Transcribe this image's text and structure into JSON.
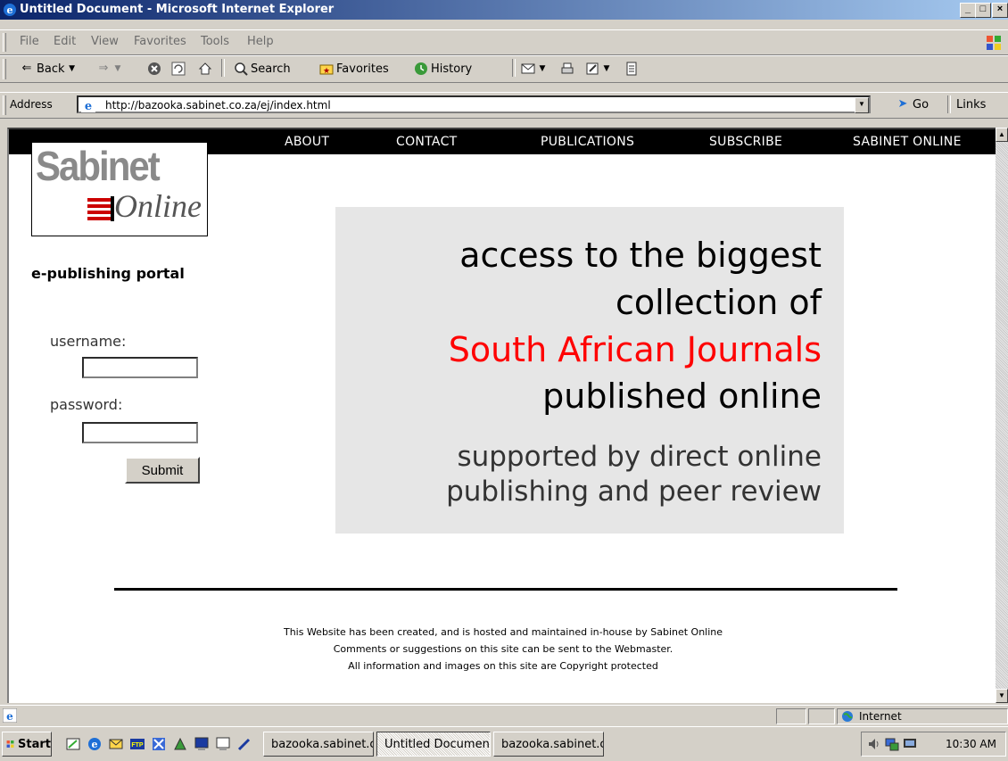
{
  "window": {
    "title": "Untitled Document - Microsoft Internet Explorer",
    "buttons": [
      "_",
      "□",
      "×"
    ]
  },
  "menu": [
    "File",
    "Edit",
    "View",
    "Favorites",
    "Tools",
    "Help"
  ],
  "toolbar": {
    "back": "Back",
    "search": "Search",
    "favorites": "Favorites",
    "history": "History"
  },
  "address": {
    "label": "Address",
    "url": "http://bazooka.sabinet.co.za/ej/index.html",
    "go": "Go",
    "links": "Links"
  },
  "nav": [
    "ABOUT",
    "CONTACT",
    "PUBLICATIONS",
    "SUBSCRIBE",
    "SABINET ONLINE"
  ],
  "logo": {
    "line1": "Sabinet",
    "line2": "Online"
  },
  "sidebar": {
    "portal": "e-publishing portal",
    "username_label": "username:",
    "password_label": "password:",
    "submit": "Submit"
  },
  "hero": {
    "line1": "access to the biggest",
    "line2": "collection of",
    "line3": "South African Journals",
    "line4": "published online",
    "line5": "supported by direct online",
    "line6": "publishing and peer review",
    "highlight_color": "#ff0000"
  },
  "footer": {
    "line1": "This Website has been created, and is hosted and maintained in-house by Sabinet Online",
    "line2": "Comments or suggestions on this site can be sent to the Webmaster.",
    "line3": "All information and images on this site are Copyright protected"
  },
  "statusbar": {
    "zone": "Internet"
  },
  "taskbar": {
    "start": "Start",
    "tasks": [
      "bazooka.sabinet.c...",
      "Untitled Document...",
      "bazooka.sabinet.c..."
    ],
    "clock": "10:30 AM"
  }
}
